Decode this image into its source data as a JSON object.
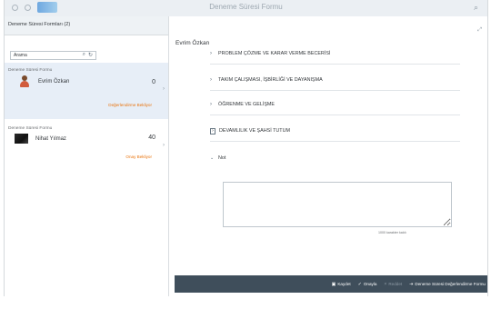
{
  "shell": {
    "title": "Deneme Süresi Formu",
    "search_icon": "search-icon"
  },
  "master": {
    "header": "Deneme Süresi Formları (2)",
    "search_placeholder": "Arama",
    "items": [
      {
        "type": "Deneme Süresi Formu",
        "name": "Evrim Özkan",
        "count": "0",
        "status": "Değerlendirme Bekliyor"
      },
      {
        "type": "Deneme Süresi Formu",
        "name": "Nihat Yılmaz",
        "count": "40",
        "status": "Onay Bekliyor"
      }
    ]
  },
  "detail": {
    "title": "Evrim Özkan",
    "sections": [
      {
        "label": "PROBLEM ÇÖZME VE KARAR VERME BECERİSİ"
      },
      {
        "label": "TAKIM ÇALIŞMASI, İŞBİRLİĞİ VE DAYANIŞMA"
      },
      {
        "label": "ÖĞRENME VE GELİŞME"
      },
      {
        "label": "DEVAMLILIK VE ŞAHSİ TUTUM"
      },
      {
        "label": "Not"
      }
    ],
    "note": {
      "value": "",
      "char_counter": "1000 karakter kaldı"
    }
  },
  "footer": {
    "save": "Kaydet",
    "approve": "Onayla",
    "reject": "Reddet",
    "form": "Deneme Süresi Değerlendirme Formu"
  },
  "colors": {
    "accent": "#0a6ed1",
    "status_orange": "#e9730c",
    "footer_bg": "#3f4e5b",
    "selected_bg": "#e7eef7"
  }
}
